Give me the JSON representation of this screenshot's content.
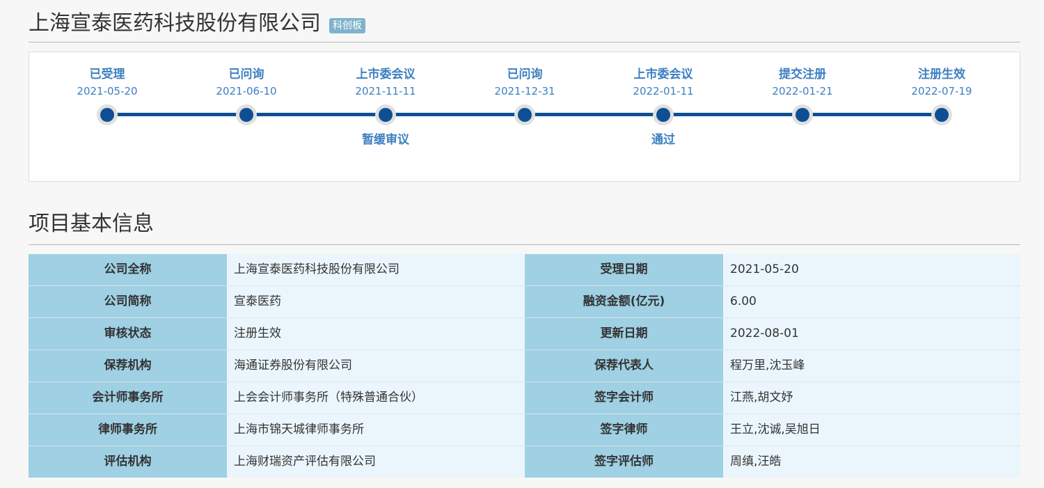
{
  "header": {
    "company_name": "上海宣泰医药科技股份有限公司",
    "board_badge": "科创板"
  },
  "timeline": {
    "steps": [
      {
        "label": "已受理",
        "date": "2021-05-20",
        "result": ""
      },
      {
        "label": "已问询",
        "date": "2021-06-10",
        "result": ""
      },
      {
        "label": "上市委会议",
        "date": "2021-11-11",
        "result": "暂缓审议"
      },
      {
        "label": "已问询",
        "date": "2021-12-31",
        "result": ""
      },
      {
        "label": "上市委会议",
        "date": "2022-01-11",
        "result": "通过"
      },
      {
        "label": "提交注册",
        "date": "2022-01-21",
        "result": ""
      },
      {
        "label": "注册生效",
        "date": "2022-07-19",
        "result": ""
      }
    ],
    "colors": {
      "line": "#0e4f94",
      "text": "#3d7fc0"
    }
  },
  "project_info": {
    "title": "项目基本信息",
    "rows": [
      [
        {
          "key": "公司全称",
          "value": "上海宣泰医药科技股份有限公司"
        },
        {
          "key": "受理日期",
          "value": "2021-05-20"
        }
      ],
      [
        {
          "key": "公司简称",
          "value": "宣泰医药"
        },
        {
          "key": "融资金额(亿元)",
          "value": "6.00"
        }
      ],
      [
        {
          "key": "审核状态",
          "value": "注册生效"
        },
        {
          "key": "更新日期",
          "value": "2022-08-01"
        }
      ],
      [
        {
          "key": "保荐机构",
          "value": "海通证券股份有限公司"
        },
        {
          "key": "保荐代表人",
          "value": "程万里,沈玉峰"
        }
      ],
      [
        {
          "key": "会计师事务所",
          "value": "上会会计师事务所（特殊普通合伙）"
        },
        {
          "key": "签字会计师",
          "value": "江燕,胡文妤"
        }
      ],
      [
        {
          "key": "律师事务所",
          "value": "上海市锦天城律师事务所"
        },
        {
          "key": "签字律师",
          "value": "王立,沈诚,吴旭日"
        }
      ],
      [
        {
          "key": "评估机构",
          "value": "上海财瑞资产评估有限公司"
        },
        {
          "key": "签字评估师",
          "value": "周缜,汪皓"
        }
      ]
    ],
    "colors": {
      "key_bg": "#9fd0e4",
      "value_bg": "#eaf6fb"
    }
  }
}
